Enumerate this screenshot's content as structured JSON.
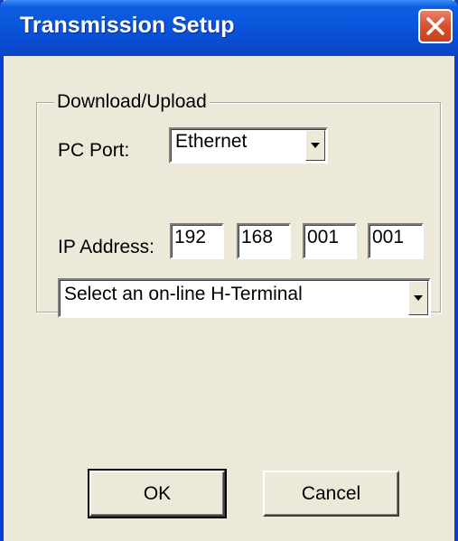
{
  "window": {
    "title": "Transmission Setup"
  },
  "group": {
    "legend": "Download/Upload"
  },
  "pc_port": {
    "label": "PC Port:",
    "value": "Ethernet"
  },
  "ip_address": {
    "label": "IP Address:",
    "octets": [
      "192",
      "168",
      "001",
      "001"
    ]
  },
  "terminal_select": {
    "value": "Select an on-line H-Terminal"
  },
  "buttons": {
    "ok": "OK",
    "cancel": "Cancel"
  },
  "icons": {
    "close": "close-icon",
    "dropdown": "chevron-down-icon"
  },
  "colors": {
    "titlebar": "#0a55dc",
    "dialog_bg": "#ece9d8",
    "close_button": "#d8502f"
  }
}
